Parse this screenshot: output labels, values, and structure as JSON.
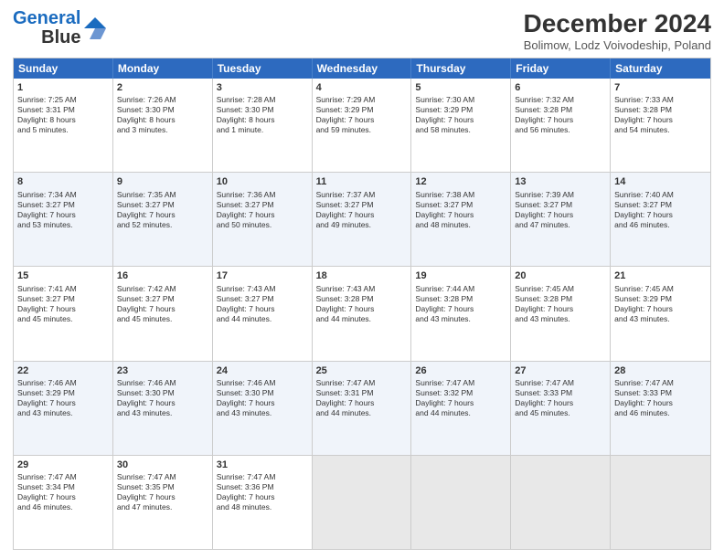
{
  "header": {
    "logo_line1": "General",
    "logo_line2": "Blue",
    "main_title": "December 2024",
    "subtitle": "Bolimow, Lodz Voivodeship, Poland"
  },
  "days_of_week": [
    "Sunday",
    "Monday",
    "Tuesday",
    "Wednesday",
    "Thursday",
    "Friday",
    "Saturday"
  ],
  "weeks": [
    [
      {
        "day": "1",
        "lines": [
          "Sunrise: 7:25 AM",
          "Sunset: 3:31 PM",
          "Daylight: 8 hours",
          "and 5 minutes."
        ]
      },
      {
        "day": "2",
        "lines": [
          "Sunrise: 7:26 AM",
          "Sunset: 3:30 PM",
          "Daylight: 8 hours",
          "and 3 minutes."
        ]
      },
      {
        "day": "3",
        "lines": [
          "Sunrise: 7:28 AM",
          "Sunset: 3:30 PM",
          "Daylight: 8 hours",
          "and 1 minute."
        ]
      },
      {
        "day": "4",
        "lines": [
          "Sunrise: 7:29 AM",
          "Sunset: 3:29 PM",
          "Daylight: 7 hours",
          "and 59 minutes."
        ]
      },
      {
        "day": "5",
        "lines": [
          "Sunrise: 7:30 AM",
          "Sunset: 3:29 PM",
          "Daylight: 7 hours",
          "and 58 minutes."
        ]
      },
      {
        "day": "6",
        "lines": [
          "Sunrise: 7:32 AM",
          "Sunset: 3:28 PM",
          "Daylight: 7 hours",
          "and 56 minutes."
        ]
      },
      {
        "day": "7",
        "lines": [
          "Sunrise: 7:33 AM",
          "Sunset: 3:28 PM",
          "Daylight: 7 hours",
          "and 54 minutes."
        ]
      }
    ],
    [
      {
        "day": "8",
        "lines": [
          "Sunrise: 7:34 AM",
          "Sunset: 3:27 PM",
          "Daylight: 7 hours",
          "and 53 minutes."
        ]
      },
      {
        "day": "9",
        "lines": [
          "Sunrise: 7:35 AM",
          "Sunset: 3:27 PM",
          "Daylight: 7 hours",
          "and 52 minutes."
        ]
      },
      {
        "day": "10",
        "lines": [
          "Sunrise: 7:36 AM",
          "Sunset: 3:27 PM",
          "Daylight: 7 hours",
          "and 50 minutes."
        ]
      },
      {
        "day": "11",
        "lines": [
          "Sunrise: 7:37 AM",
          "Sunset: 3:27 PM",
          "Daylight: 7 hours",
          "and 49 minutes."
        ]
      },
      {
        "day": "12",
        "lines": [
          "Sunrise: 7:38 AM",
          "Sunset: 3:27 PM",
          "Daylight: 7 hours",
          "and 48 minutes."
        ]
      },
      {
        "day": "13",
        "lines": [
          "Sunrise: 7:39 AM",
          "Sunset: 3:27 PM",
          "Daylight: 7 hours",
          "and 47 minutes."
        ]
      },
      {
        "day": "14",
        "lines": [
          "Sunrise: 7:40 AM",
          "Sunset: 3:27 PM",
          "Daylight: 7 hours",
          "and 46 minutes."
        ]
      }
    ],
    [
      {
        "day": "15",
        "lines": [
          "Sunrise: 7:41 AM",
          "Sunset: 3:27 PM",
          "Daylight: 7 hours",
          "and 45 minutes."
        ]
      },
      {
        "day": "16",
        "lines": [
          "Sunrise: 7:42 AM",
          "Sunset: 3:27 PM",
          "Daylight: 7 hours",
          "and 45 minutes."
        ]
      },
      {
        "day": "17",
        "lines": [
          "Sunrise: 7:43 AM",
          "Sunset: 3:27 PM",
          "Daylight: 7 hours",
          "and 44 minutes."
        ]
      },
      {
        "day": "18",
        "lines": [
          "Sunrise: 7:43 AM",
          "Sunset: 3:28 PM",
          "Daylight: 7 hours",
          "and 44 minutes."
        ]
      },
      {
        "day": "19",
        "lines": [
          "Sunrise: 7:44 AM",
          "Sunset: 3:28 PM",
          "Daylight: 7 hours",
          "and 43 minutes."
        ]
      },
      {
        "day": "20",
        "lines": [
          "Sunrise: 7:45 AM",
          "Sunset: 3:28 PM",
          "Daylight: 7 hours",
          "and 43 minutes."
        ]
      },
      {
        "day": "21",
        "lines": [
          "Sunrise: 7:45 AM",
          "Sunset: 3:29 PM",
          "Daylight: 7 hours",
          "and 43 minutes."
        ]
      }
    ],
    [
      {
        "day": "22",
        "lines": [
          "Sunrise: 7:46 AM",
          "Sunset: 3:29 PM",
          "Daylight: 7 hours",
          "and 43 minutes."
        ]
      },
      {
        "day": "23",
        "lines": [
          "Sunrise: 7:46 AM",
          "Sunset: 3:30 PM",
          "Daylight: 7 hours",
          "and 43 minutes."
        ]
      },
      {
        "day": "24",
        "lines": [
          "Sunrise: 7:46 AM",
          "Sunset: 3:30 PM",
          "Daylight: 7 hours",
          "and 43 minutes."
        ]
      },
      {
        "day": "25",
        "lines": [
          "Sunrise: 7:47 AM",
          "Sunset: 3:31 PM",
          "Daylight: 7 hours",
          "and 44 minutes."
        ]
      },
      {
        "day": "26",
        "lines": [
          "Sunrise: 7:47 AM",
          "Sunset: 3:32 PM",
          "Daylight: 7 hours",
          "and 44 minutes."
        ]
      },
      {
        "day": "27",
        "lines": [
          "Sunrise: 7:47 AM",
          "Sunset: 3:33 PM",
          "Daylight: 7 hours",
          "and 45 minutes."
        ]
      },
      {
        "day": "28",
        "lines": [
          "Sunrise: 7:47 AM",
          "Sunset: 3:33 PM",
          "Daylight: 7 hours",
          "and 46 minutes."
        ]
      }
    ],
    [
      {
        "day": "29",
        "lines": [
          "Sunrise: 7:47 AM",
          "Sunset: 3:34 PM",
          "Daylight: 7 hours",
          "and 46 minutes."
        ]
      },
      {
        "day": "30",
        "lines": [
          "Sunrise: 7:47 AM",
          "Sunset: 3:35 PM",
          "Daylight: 7 hours",
          "and 47 minutes."
        ]
      },
      {
        "day": "31",
        "lines": [
          "Sunrise: 7:47 AM",
          "Sunset: 3:36 PM",
          "Daylight: 7 hours",
          "and 48 minutes."
        ]
      },
      null,
      null,
      null,
      null
    ]
  ]
}
